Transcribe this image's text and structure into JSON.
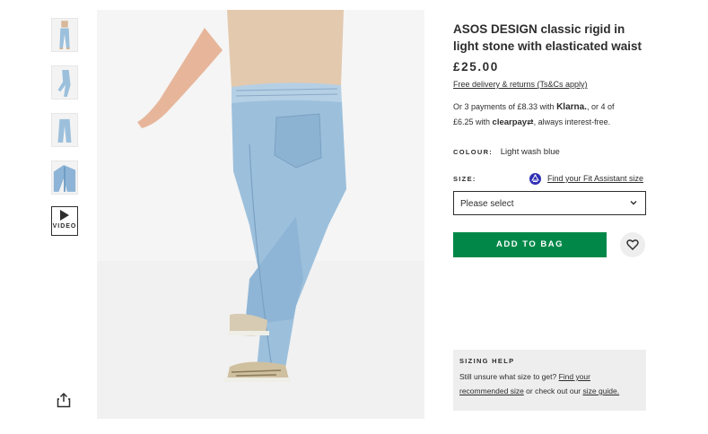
{
  "product": {
    "title": "ASOS DESIGN classic rigid in light stone with elasticated waist",
    "price": "£25.00",
    "delivery_link": "Free delivery & returns (Ts&Cs apply)",
    "payment": {
      "line1_prefix": "Or 3 payments of £8.33 with ",
      "klarna": "Klarna.",
      "line1_suffix": ", or 4 of",
      "line2_prefix": "£6.25 with ",
      "clearpay": "clearpay",
      "line2_suffix": ", always interest-free."
    },
    "colour_label": "COLOUR:",
    "colour_value": "Light wash blue",
    "size_label": "SIZE:",
    "fit_assistant_link": "Find your Fit Assistant size",
    "size_select_value": "Please select",
    "add_to_bag": "ADD TO BAG"
  },
  "sizing_help": {
    "heading": "SIZING HELP",
    "text_prefix": "Still unsure what size to get? ",
    "link1": "Find your recommended size",
    "text_middle": " or check out our ",
    "link2": "size guide."
  },
  "gallery": {
    "video_label": "VIDEO",
    "thumbnails": [
      "thumbnail-1",
      "thumbnail-2",
      "thumbnail-3",
      "thumbnail-4"
    ]
  },
  "colors": {
    "add_button": "#018849",
    "fit_icon": "#2f2fb4",
    "denim": "#9cc0dc"
  },
  "icons": {
    "share": "share-icon",
    "heart": "heart-icon",
    "chevron": "chevron-down-icon",
    "play": "play-icon"
  }
}
